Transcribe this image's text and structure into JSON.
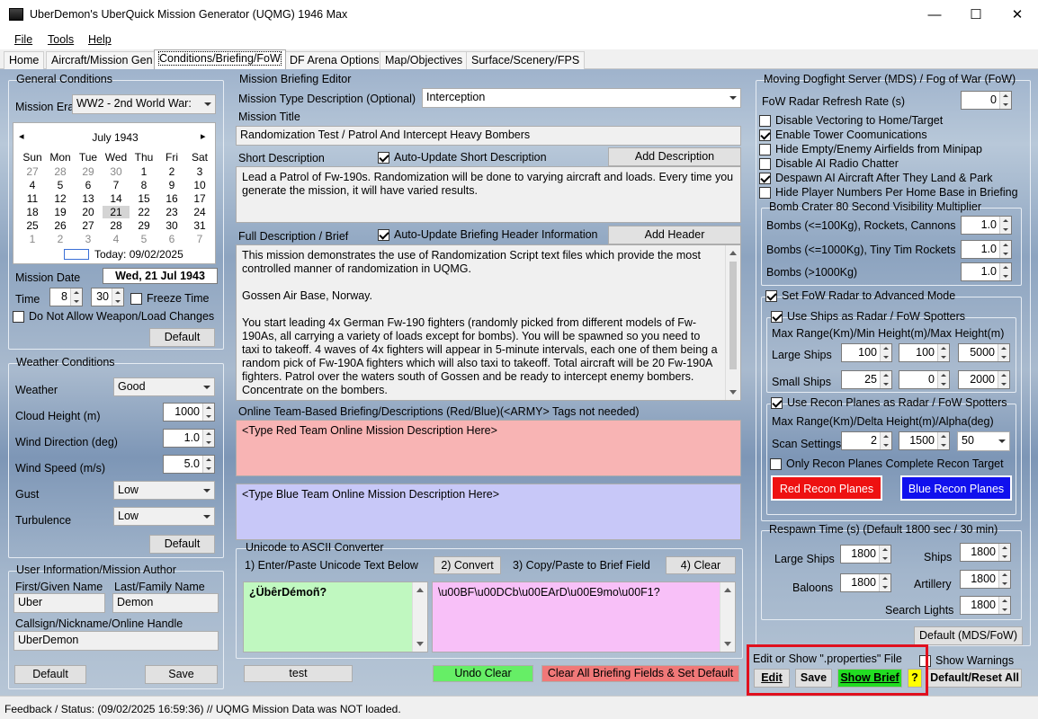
{
  "window": {
    "title": "UberDemon's UberQuick Mission Generator (UQMG) 1946 Max",
    "minimize": "—",
    "maximize": "☐",
    "close": "✕"
  },
  "menu": [
    "File",
    "Tools",
    "Help"
  ],
  "tabs": [
    "Home",
    "Aircraft/Mission Gen",
    "Conditions/Briefing/FoW",
    "DF Arena Options",
    "Map/Objectives",
    "Surface/Scenery/FPS"
  ],
  "general": {
    "title": "General Conditions",
    "mission_era_label": "Mission Era",
    "mission_era_value": "WW2 - 2nd World War:",
    "calendar": {
      "month": "July 1943",
      "prev": "◂",
      "next": "▸",
      "weekdays": [
        "Sun",
        "Mon",
        "Tue",
        "Wed",
        "Thu",
        "Fri",
        "Sat"
      ],
      "weeks": [
        [
          "27",
          "28",
          "29",
          "30",
          "1",
          "2",
          "3"
        ],
        [
          "4",
          "5",
          "6",
          "7",
          "8",
          "9",
          "10"
        ],
        [
          "11",
          "12",
          "13",
          "14",
          "15",
          "16",
          "17"
        ],
        [
          "18",
          "19",
          "20",
          "21",
          "22",
          "23",
          "24"
        ],
        [
          "25",
          "26",
          "27",
          "28",
          "29",
          "30",
          "31"
        ],
        [
          "1",
          "2",
          "3",
          "4",
          "5",
          "6",
          "7"
        ]
      ],
      "selected": "21",
      "today": "Today: 09/02/2025"
    },
    "mission_date_label": "Mission Date",
    "mission_date_value": "Wed, 21 Jul 1943",
    "time_label": "Time",
    "time_hour": "8",
    "time_min": "30",
    "freeze_time": "Freeze Time",
    "no_weapon_changes": "Do Not Allow Weapon/Load Changes",
    "default_btn": "Default"
  },
  "weather": {
    "title": "Weather Conditions",
    "weather_label": "Weather",
    "weather_value": "Good",
    "cloud_label": "Cloud Height (m)",
    "cloud_value": "1000",
    "wind_dir_label": "Wind Direction (deg)",
    "wind_dir_value": "1.0",
    "wind_speed_label": "Wind Speed (m/s)",
    "wind_speed_value": "5.0",
    "gust_label": "Gust",
    "gust_value": "Low",
    "turb_label": "Turbulence",
    "turb_value": "Low",
    "default_btn": "Default"
  },
  "user": {
    "title": "User Information/Mission Author",
    "first_label": "First/Given Name",
    "first_value": "Uber",
    "last_label": "Last/Family Name",
    "last_value": "Demon",
    "callsign_label": "Callsign/Nickname/Online Handle",
    "callsign_value": "UberDemon",
    "default_btn": "Default",
    "save_btn": "Save"
  },
  "briefing": {
    "title": "Mission Briefing Editor",
    "type_label": "Mission Type Description (Optional)",
    "type_value": "Interception",
    "mission_title_label": "Mission Title",
    "mission_title_value": "Randomization Test / Patrol And Intercept Heavy Bombers",
    "short_label": "Short Description",
    "auto_short": "Auto-Update Short Description",
    "add_desc_btn": "Add Description",
    "short_text": "Lead a Patrol of Fw-190s.  Randomization will be done to varying aircraft and loads.  Every time you generate the mission, it will have varied results.",
    "full_label": "Full Description / Brief",
    "auto_header": "Auto-Update Briefing Header Information",
    "add_header_btn": "Add Header",
    "full_p1": "This mission demonstrates the use of Randomization Script text files which provide the most controlled manner of randomization in UQMG.",
    "full_p2": "Gossen Air Base, Norway.",
    "full_p3": "You start leading 4x German Fw-190 fighters (randomly picked from different models of Fw-190As, all carrying a variety of loads except for bombs).  You will be spawned so you need to taxi to takeoff.  4 waves of 4x fighters will appear in 5-minute intervals, each one of them being a random pick of Fw-190A fighters which will also taxi to takeoff.  Total aircraft will be 20 Fw-190A fighters.  Patrol over the waters south of Gossen and be ready to intercept enemy bombers.  Concentrate on the bombers.",
    "online_label": "Online Team-Based Briefing/Descriptions (Red/Blue)(<ARMY> Tags not needed)",
    "red_text": "<Type Red Team Online Mission Description Here>",
    "blue_text": "<Type Blue Team Online Mission Description Here>"
  },
  "unicode": {
    "title": "Unicode to ASCII Converter",
    "step1": "1) Enter/Paste Unicode Text Below",
    "convert_btn": "2) Convert",
    "step3": "3) Copy/Paste to Brief Field",
    "clear_btn": "4) Clear",
    "input_text": "¿ÜbêrDémoñ?",
    "output_text": "\\u00BF\\u00DCb\\u00EArD\\u00E9mo\\u00F1?"
  },
  "bottom_buttons": {
    "test": "test",
    "undo": "Undo Clear",
    "clear_all": "Clear All Briefing Fields & Set Default"
  },
  "fow": {
    "title": "Moving Dogfight Server (MDS) / Fog of War (FoW)",
    "refresh_label": "FoW Radar Refresh Rate (s)",
    "refresh_value": "0",
    "opts": [
      {
        "label": "Disable Vectoring to Home/Target",
        "checked": false
      },
      {
        "label": "Enable Tower Coomunications",
        "checked": true
      },
      {
        "label": "Hide Empty/Enemy Airfields from Minipap",
        "checked": false
      },
      {
        "label": "Disable AI Radio Chatter",
        "checked": false
      },
      {
        "label": "Despawn AI Aircraft After They Land & Park",
        "checked": true
      },
      {
        "label": "Hide Player Numbers Per Home Base in Briefing",
        "checked": false
      }
    ],
    "crater_title": "Bomb Crater 80 Second Visibility Multiplier",
    "crater": [
      {
        "label": "Bombs (<=100Kg), Rockets, Cannons",
        "value": "1.0"
      },
      {
        "label": "Bombs (<=1000Kg), Tiny Tim Rockets",
        "value": "1.0"
      },
      {
        "label": "Bombs (>1000Kg)",
        "value": "1.0"
      }
    ],
    "advanced": "Set FoW Radar to Advanced Mode",
    "ships_radar": "Use Ships as Radar / FoW Spotters",
    "ships_range": "Max Range(Km)/Min Height(m)/Max Height(m)",
    "large_ships_label": "Large Ships",
    "large_ships": [
      "100",
      "100",
      "5000"
    ],
    "small_ships_label": "Small Ships",
    "small_ships": [
      "25",
      "0",
      "2000"
    ],
    "recon_radar": "Use Recon Planes as Radar / FoW Spotters",
    "recon_range": "Max Range(Km)/Delta Height(m)/Alpha(deg)",
    "scan_label": "Scan Settings",
    "scan": [
      "2",
      "1500",
      "50"
    ],
    "only_recon": "Only Recon Planes Complete Recon Target",
    "red_recon": "Red Recon Planes",
    "blue_recon": "Blue Recon Planes",
    "respawn_title": "Respawn Time (s) (Default 1800 sec / 30 min)",
    "large_ships_r": "Large Ships",
    "large_ships_r_val": "1800",
    "ships_r": "Ships",
    "ships_r_val": "1800",
    "balloons_r": "Baloons",
    "balloons_r_val": "1800",
    "artillery_r": "Artillery",
    "artillery_r_val": "1800",
    "search_r": "Search Lights",
    "search_r_val": "1800",
    "default_btn": "Default (MDS/FoW)"
  },
  "properties": {
    "label": "Edit or Show \".properties\" File",
    "show_warnings": "Show Warnings",
    "edit": "Edit",
    "save": "Save",
    "show_brief": "Show Brief",
    "help": "?",
    "reset_all": "Default/Reset All"
  },
  "status": "Feedback / Status:  (09/02/2025 16:59:36) // UQMG Mission Data was NOT loaded.",
  "colors": {
    "red_field": "#f8b4b4",
    "blue_field": "#c8c8f8",
    "green_field": "#c0f8c0",
    "pink_field": "#f8c0f8",
    "red_btn": "#ee1111",
    "blue_btn": "#1010ee",
    "highlight": "#e0101e"
  }
}
